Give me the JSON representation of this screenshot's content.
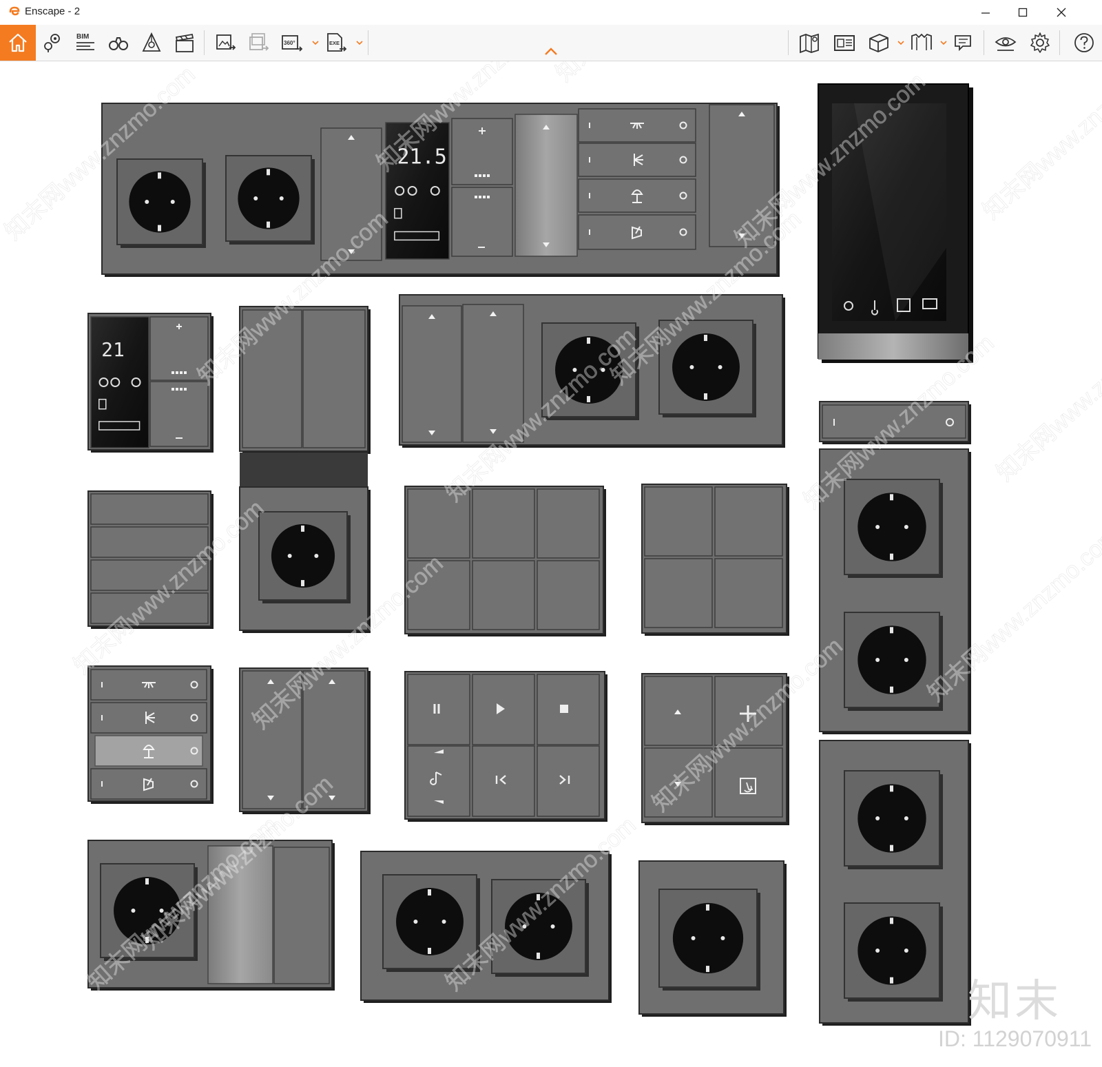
{
  "window": {
    "title": "Enscape - 2",
    "accent": "#f47b20"
  },
  "toolbar": {
    "left": [
      {
        "name": "home-icon",
        "active": true
      },
      {
        "name": "map-pin-icon"
      },
      {
        "name": "bim-icon",
        "label": "BIM"
      },
      {
        "name": "binoculars-icon"
      },
      {
        "name": "asset-library-icon"
      },
      {
        "name": "clapperboard-icon"
      },
      {
        "name": "export-image-icon"
      },
      {
        "name": "batch-export-icon"
      },
      {
        "name": "export-panorama-icon",
        "label": "360°",
        "dropdown": true
      },
      {
        "name": "export-exe-icon",
        "label": "EXE",
        "dropdown": true
      }
    ],
    "right": [
      {
        "name": "map-view-icon"
      },
      {
        "name": "image-gallery-icon"
      },
      {
        "name": "cube-icon",
        "dropdown": true
      },
      {
        "name": "book-icon",
        "dropdown": true
      },
      {
        "name": "chat-icon"
      },
      {
        "name": "eye-icon"
      },
      {
        "name": "gear-icon"
      },
      {
        "name": "help-icon"
      }
    ]
  },
  "render": {
    "panel_color": "#6f6f6f",
    "panel_dark": "#3a3a3a",
    "socket_color": "#0d0d0d",
    "display_digits": "21.5",
    "display_digits_small": "21"
  },
  "watermark": {
    "logo": "知末",
    "id": "ID: 1129070911",
    "tiles": [
      "知末网www.znzmo.com"
    ]
  }
}
